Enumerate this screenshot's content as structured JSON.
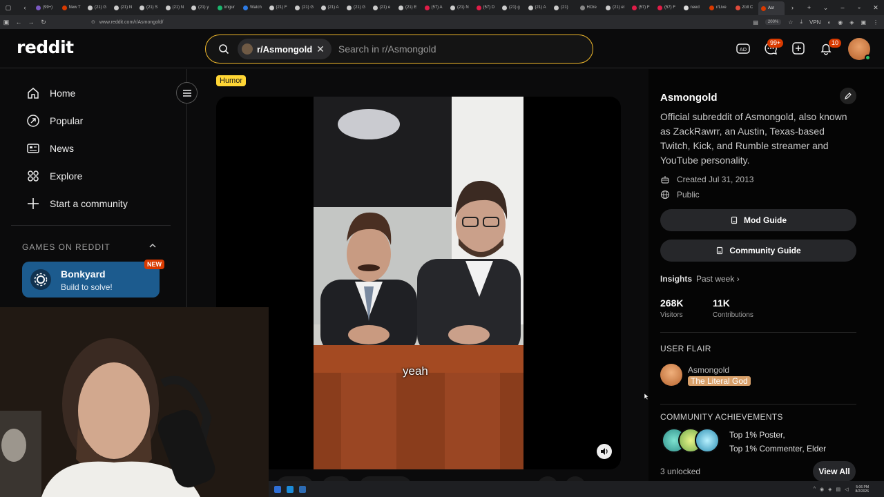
{
  "browser": {
    "tabs": [
      {
        "label": "(99+)",
        "color": "#7b59c2"
      },
      {
        "label": "New T",
        "color": "#d93a00"
      },
      {
        "label": "(21) G",
        "color": "#cccccc"
      },
      {
        "label": "(21) N",
        "color": "#cccccc"
      },
      {
        "label": "(21) S",
        "color": "#cccccc"
      },
      {
        "label": "(21) N",
        "color": "#cccccc"
      },
      {
        "label": "(21) y",
        "color": "#cccccc"
      },
      {
        "label": "Imgur",
        "color": "#1bb76e"
      },
      {
        "label": "Watch",
        "color": "#2d7be5"
      },
      {
        "label": "(21) F",
        "color": "#cccccc"
      },
      {
        "label": "(21) G",
        "color": "#cccccc"
      },
      {
        "label": "(21) A",
        "color": "#cccccc"
      },
      {
        "label": "(21) G",
        "color": "#cccccc"
      },
      {
        "label": "(21) e",
        "color": "#cccccc"
      },
      {
        "label": "(21) E",
        "color": "#cccccc"
      },
      {
        "label": "(57) A",
        "color": "#e11d48"
      },
      {
        "label": "(21) N",
        "color": "#cccccc"
      },
      {
        "label": "(57) D",
        "color": "#e11d48"
      },
      {
        "label": "(21) g",
        "color": "#cccccc"
      },
      {
        "label": "(21) A",
        "color": "#cccccc"
      },
      {
        "label": "(21)",
        "color": "#cccccc"
      },
      {
        "label": "HOre",
        "color": "#888888"
      },
      {
        "label": "(21) el",
        "color": "#cccccc"
      },
      {
        "label": "(57) F",
        "color": "#e11d48"
      },
      {
        "label": "(57) F",
        "color": "#e11d48"
      },
      {
        "label": "need",
        "color": "#dddddd"
      },
      {
        "label": "r/Live",
        "color": "#d93a00"
      },
      {
        "label": "Zoll C",
        "color": "#e04b3b"
      },
      {
        "label": "Asr",
        "color": "#d93a00",
        "active": true
      }
    ],
    "url": "www.reddit.com/r/Asmongold/",
    "zoom": "200%",
    "vpn": "VPN"
  },
  "header": {
    "logo": "reddit",
    "chip_label": "r/Asmongold",
    "search_placeholder": "Search in r/Asmongold",
    "chat_badge": "99+",
    "notif_badge": "10"
  },
  "sidebar": {
    "nav": [
      {
        "label": "Home",
        "icon": "home-icon"
      },
      {
        "label": "Popular",
        "icon": "popular-icon"
      },
      {
        "label": "News",
        "icon": "news-icon"
      },
      {
        "label": "Explore",
        "icon": "explore-icon"
      },
      {
        "label": "Start a community",
        "icon": "plus-icon"
      }
    ],
    "games_heading": "GAMES ON REDDIT",
    "game": {
      "name": "Bonkyard",
      "subtitle": "Build to solve!",
      "badge": "NEW"
    }
  },
  "post": {
    "flair": "Humor",
    "caption": "yeah"
  },
  "community": {
    "name": "Asmongold",
    "description": "Official subreddit of Asmongold, also known as ZackRawrr, an Austin, Texas-based Twitch, Kick, and Rumble streamer and YouTube personality.",
    "created": "Created Jul 31, 2013",
    "visibility": "Public",
    "mod_guide": "Mod Guide",
    "community_guide": "Community Guide",
    "insights_label": "Insights",
    "insights_period": "Past week",
    "visitors_value": "268K",
    "visitors_label": "Visitors",
    "contrib_value": "11K",
    "contrib_label": "Contributions",
    "user_flair_heading": "USER FLAIR",
    "user_flair_name": "Asmongold",
    "user_flair_tag": "The Literal God",
    "achievements_heading": "COMMUNITY ACHIEVEMENTS",
    "achievement_line1": "Top 1% Poster,",
    "achievement_line2": "Top 1% Commenter, Elder",
    "unlocked": "3 unlocked",
    "view_all": "View All"
  },
  "taskbar": {
    "time": "5:06 PM",
    "date": "8/2/2026"
  },
  "colors": {
    "accent_search_border": "#f3bb2c",
    "reddit_orange": "#d93a00",
    "game_card": "#1c5b8e",
    "flair_tag": "#ffd635"
  }
}
